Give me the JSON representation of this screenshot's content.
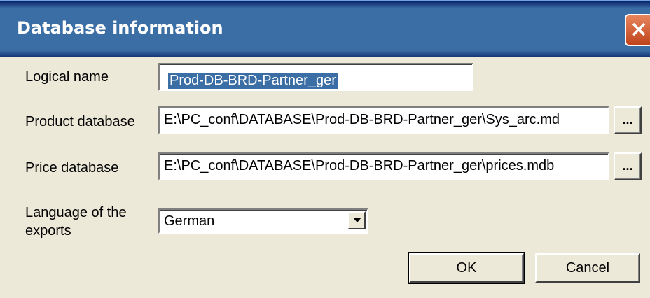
{
  "dialog": {
    "title": "Database information"
  },
  "form": {
    "logical_name": {
      "label": "Logical name",
      "value": "Prod-DB-BRD-Partner_ger"
    },
    "product_database": {
      "label": "Product database",
      "value": "E:\\PC_conf\\DATABASE\\Prod-DB-BRD-Partner_ger\\Sys_arc.md",
      "browse_label": "..."
    },
    "price_database": {
      "label": "Price database",
      "value": "E:\\PC_conf\\DATABASE\\Prod-DB-BRD-Partner_ger\\prices.mdb",
      "browse_label": "..."
    },
    "language": {
      "label_line1": "Language of the",
      "label_line2": "exports",
      "selected": "German"
    }
  },
  "buttons": {
    "ok": "OK",
    "cancel": "Cancel"
  },
  "colors": {
    "titlebar": "#3a6ea5",
    "close": "#d4562a",
    "dialog_bg": "#ece9d8"
  }
}
